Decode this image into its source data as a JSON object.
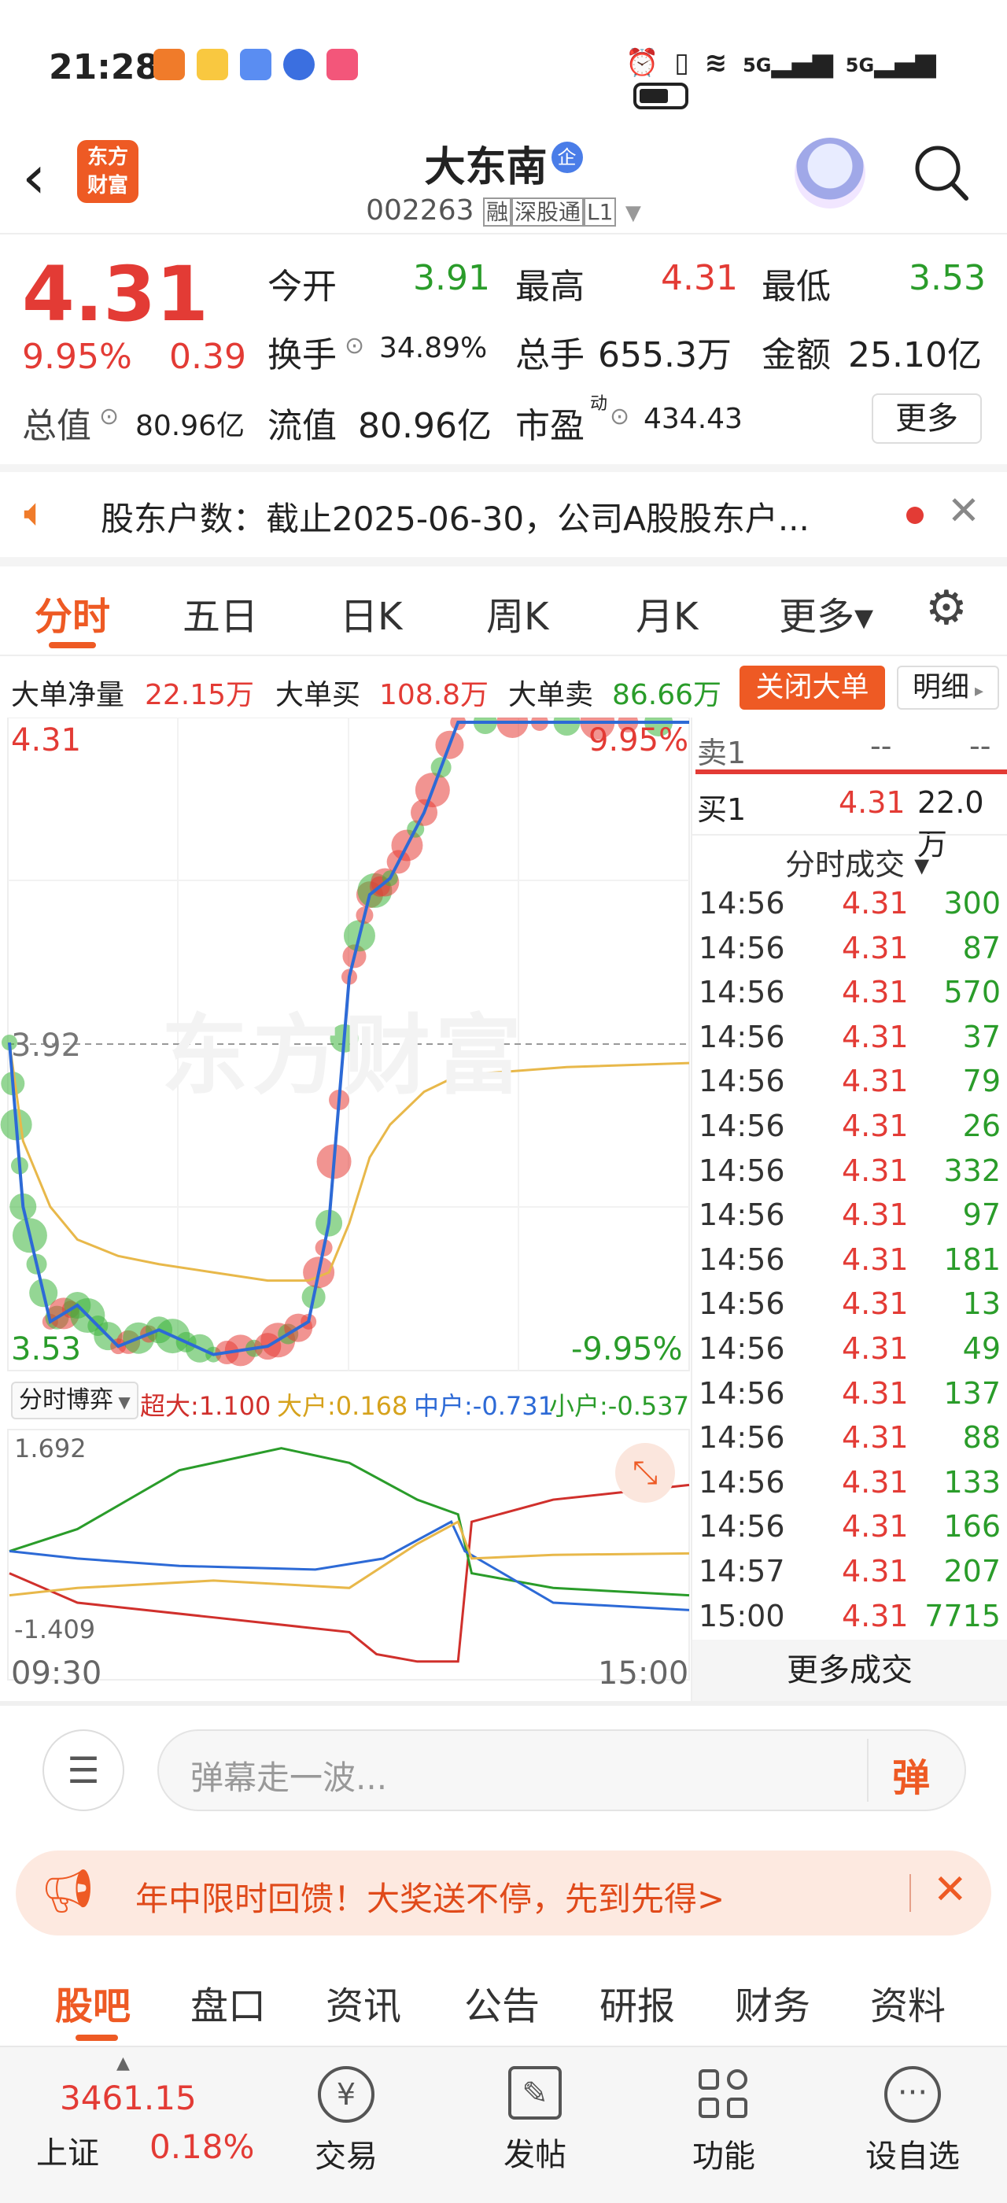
{
  "status_bar": {
    "time": "21:28",
    "network_1": "5G",
    "network_2": "5G"
  },
  "header": {
    "logo_text": "东方财富",
    "title": "大东南",
    "title_badge": "企",
    "code": "002263",
    "tag_rong": "融",
    "tag_sgt": "深股通",
    "tag_level": "L1"
  },
  "quote": {
    "price": "4.31",
    "change_pct": "9.95%",
    "change_amt": "0.39",
    "open_label": "今开",
    "open": "3.91",
    "high_label": "最高",
    "high": "4.31",
    "low_label": "最低",
    "low": "3.53",
    "turnover_label": "换手",
    "turnover": "34.89%",
    "volume_label": "总手",
    "volume": "655.3万",
    "amount_label": "金额",
    "amount": "25.10亿",
    "mcap_label": "总值",
    "mcap": "80.96亿",
    "float_label": "流值",
    "float": "80.96亿",
    "pe_label": "市盈",
    "pe_sup": "动",
    "pe": "434.43",
    "more_label": "更多"
  },
  "notice": {
    "text": "股东户数：截止2025-06-30，公司A股股东户..."
  },
  "chart_tabs": [
    "分时",
    "五日",
    "日K",
    "周K",
    "月K",
    "更多▾"
  ],
  "big_order": {
    "net_label": "大单净量",
    "net": "22.15万",
    "buy_label": "大单买",
    "buy": "108.8万",
    "sell_label": "大单卖",
    "sell": "86.66万",
    "close_btn": "关闭大单",
    "detail_btn": "明细"
  },
  "chart_labels": {
    "top_price": "4.31",
    "top_pct": "9.95%",
    "mid_price": "3.92",
    "bottom_price": "3.53",
    "bottom_pct": "-9.95%",
    "watermark": "东方财富",
    "indicator_name": "分时博弈",
    "super_label": "超大:1.100",
    "large_label": "大户:0.168",
    "mid_label": "中户:-0.731",
    "small_label": "小户:-0.537",
    "ind_top": "1.692",
    "ind_bottom": "-1.409",
    "time_start": "09:30",
    "time_end": "15:00"
  },
  "chart_data": {
    "type": "line",
    "x": [
      "09:30",
      "15:00"
    ],
    "ylim": [
      3.53,
      4.31
    ],
    "reference_price": 3.92,
    "series": [
      {
        "values": [
          3.92,
          3.72,
          3.58,
          3.6,
          3.55,
          3.57,
          3.54,
          3.55,
          3.58,
          3.7,
          4.0,
          4.1,
          4.12,
          4.2,
          4.31,
          4.31,
          4.31
        ]
      }
    ]
  },
  "order_book": {
    "sell1_label": "卖1",
    "sell1_price": "--",
    "sell1_vol": "--",
    "buy1_label": "买1",
    "buy1_price": "4.31",
    "buy1_vol": "22.0万",
    "trades_title": "分时成交 ▾",
    "trades": [
      {
        "time": "14:56",
        "price": "4.31",
        "vol": "300"
      },
      {
        "time": "14:56",
        "price": "4.31",
        "vol": "87"
      },
      {
        "time": "14:56",
        "price": "4.31",
        "vol": "570"
      },
      {
        "time": "14:56",
        "price": "4.31",
        "vol": "37"
      },
      {
        "time": "14:56",
        "price": "4.31",
        "vol": "79"
      },
      {
        "time": "14:56",
        "price": "4.31",
        "vol": "26"
      },
      {
        "time": "14:56",
        "price": "4.31",
        "vol": "332"
      },
      {
        "time": "14:56",
        "price": "4.31",
        "vol": "97"
      },
      {
        "time": "14:56",
        "price": "4.31",
        "vol": "181"
      },
      {
        "time": "14:56",
        "price": "4.31",
        "vol": "13"
      },
      {
        "time": "14:56",
        "price": "4.31",
        "vol": "49"
      },
      {
        "time": "14:56",
        "price": "4.31",
        "vol": "137"
      },
      {
        "time": "14:56",
        "price": "4.31",
        "vol": "88"
      },
      {
        "time": "14:56",
        "price": "4.31",
        "vol": "133"
      },
      {
        "time": "14:56",
        "price": "4.31",
        "vol": "166"
      },
      {
        "time": "14:57",
        "price": "4.31",
        "vol": "207"
      },
      {
        "time": "15:00",
        "price": "4.31",
        "vol": "7715"
      }
    ],
    "more_trades": "更多成交"
  },
  "comment_bar": {
    "placeholder": "弹幕走一波...",
    "danmu_btn": "弹"
  },
  "promo": {
    "text": "年中限时回馈！大奖送不停，先到先得>"
  },
  "bottom_tabs": [
    "股吧",
    "盘口",
    "资讯",
    "公告",
    "研报",
    "财务",
    "资料"
  ],
  "footer": {
    "index_value": "3461.15",
    "index_name": "上证",
    "index_change": "0.18%",
    "trade": "交易",
    "post": "发帖",
    "functions": "功能",
    "watchlist": "设自选"
  },
  "colors": {
    "up": "#e33b35",
    "down": "#2a9c2a",
    "accent": "#f05a24"
  }
}
